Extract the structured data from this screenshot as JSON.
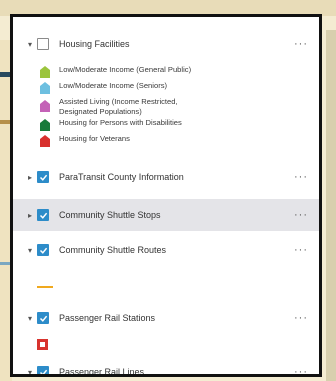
{
  "layers": {
    "housing": {
      "label": "Housing Facilities",
      "checked": false,
      "expanded": true,
      "more": "···"
    },
    "legend": [
      {
        "label": "Low/Moderate Income (General Public)",
        "color": "#9bc43c",
        "icon": "house-icon"
      },
      {
        "label": "Low/Moderate Income (Seniors)",
        "color": "#6dbfe0",
        "icon": "house-icon"
      },
      {
        "label": "Assisted Living (Income Restricted,",
        "label2": "Designated Populations)",
        "color": "#c462b7",
        "icon": "house-icon"
      },
      {
        "label": "Housing for Persons with Disabilities",
        "color": "#177a3a",
        "icon": "house-icon"
      },
      {
        "label": "Housing for Veterans",
        "color": "#d8302e",
        "icon": "house-icon"
      }
    ],
    "paratransit": {
      "label": "ParaTransit County Information",
      "checked": true,
      "expanded": false,
      "more": "···"
    },
    "shuttle_stops": {
      "label": "Community Shuttle Stops",
      "checked": true,
      "expanded": false,
      "more": "···"
    },
    "shuttle_routes": {
      "label": "Community Shuttle Routes",
      "checked": true,
      "expanded": true,
      "more": "···",
      "symbol_color": "#f0a91e"
    },
    "rail_stations": {
      "label": "Passenger Rail Stations",
      "checked": true,
      "expanded": true,
      "more": "···",
      "symbol_color": "#d8332e"
    },
    "rail_lines": {
      "label": "Passenger Rail Lines",
      "checked": true,
      "expanded": true,
      "more": "···"
    }
  },
  "colors": {
    "checkbox_on": "#2d8cc9",
    "highlight": "#e4e4e8",
    "panel_border": "#111111"
  }
}
